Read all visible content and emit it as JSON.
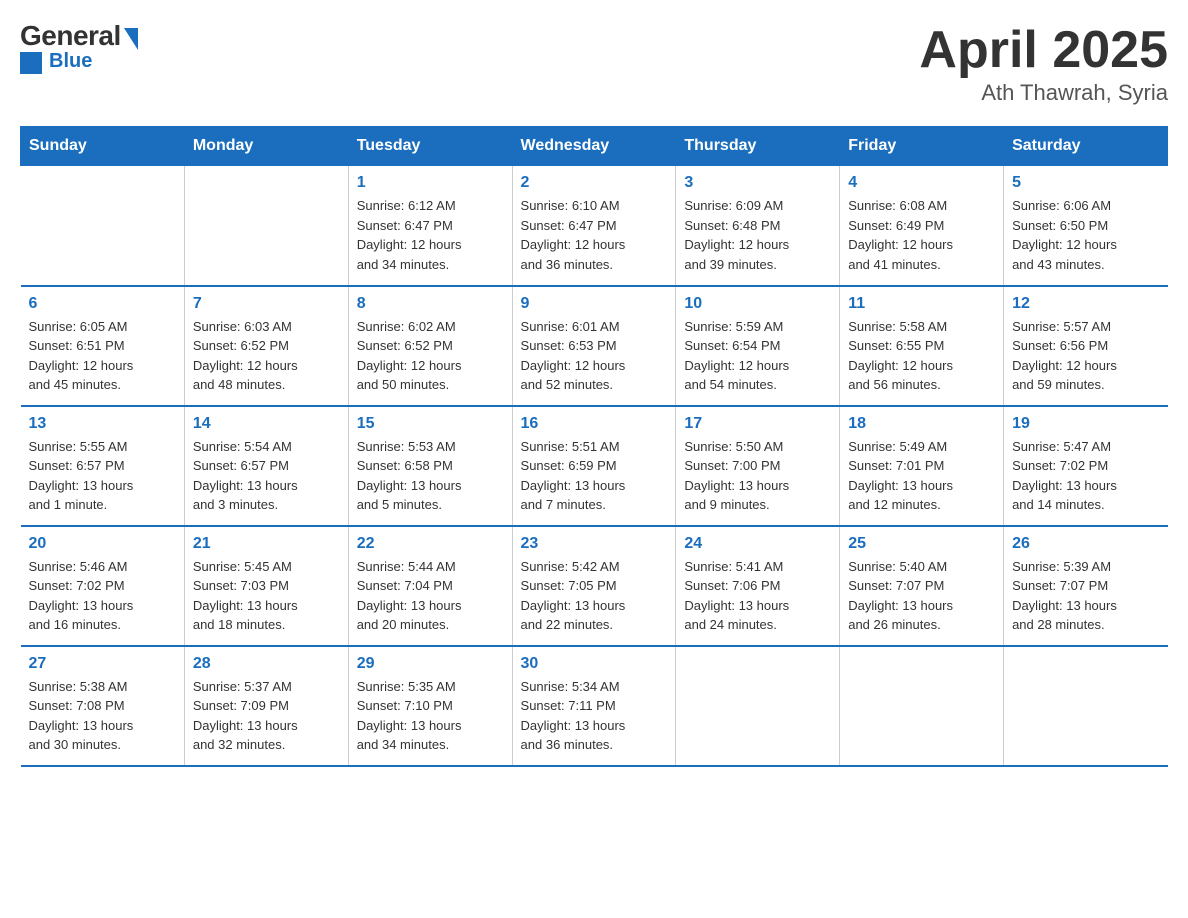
{
  "header": {
    "logo": {
      "general": "General",
      "blue": "Blue"
    },
    "title": "April 2025",
    "subtitle": "Ath Thawrah, Syria"
  },
  "weekdays": [
    "Sunday",
    "Monday",
    "Tuesday",
    "Wednesday",
    "Thursday",
    "Friday",
    "Saturday"
  ],
  "weeks": [
    [
      {
        "day": "",
        "info": ""
      },
      {
        "day": "",
        "info": ""
      },
      {
        "day": "1",
        "info": "Sunrise: 6:12 AM\nSunset: 6:47 PM\nDaylight: 12 hours\nand 34 minutes."
      },
      {
        "day": "2",
        "info": "Sunrise: 6:10 AM\nSunset: 6:47 PM\nDaylight: 12 hours\nand 36 minutes."
      },
      {
        "day": "3",
        "info": "Sunrise: 6:09 AM\nSunset: 6:48 PM\nDaylight: 12 hours\nand 39 minutes."
      },
      {
        "day": "4",
        "info": "Sunrise: 6:08 AM\nSunset: 6:49 PM\nDaylight: 12 hours\nand 41 minutes."
      },
      {
        "day": "5",
        "info": "Sunrise: 6:06 AM\nSunset: 6:50 PM\nDaylight: 12 hours\nand 43 minutes."
      }
    ],
    [
      {
        "day": "6",
        "info": "Sunrise: 6:05 AM\nSunset: 6:51 PM\nDaylight: 12 hours\nand 45 minutes."
      },
      {
        "day": "7",
        "info": "Sunrise: 6:03 AM\nSunset: 6:52 PM\nDaylight: 12 hours\nand 48 minutes."
      },
      {
        "day": "8",
        "info": "Sunrise: 6:02 AM\nSunset: 6:52 PM\nDaylight: 12 hours\nand 50 minutes."
      },
      {
        "day": "9",
        "info": "Sunrise: 6:01 AM\nSunset: 6:53 PM\nDaylight: 12 hours\nand 52 minutes."
      },
      {
        "day": "10",
        "info": "Sunrise: 5:59 AM\nSunset: 6:54 PM\nDaylight: 12 hours\nand 54 minutes."
      },
      {
        "day": "11",
        "info": "Sunrise: 5:58 AM\nSunset: 6:55 PM\nDaylight: 12 hours\nand 56 minutes."
      },
      {
        "day": "12",
        "info": "Sunrise: 5:57 AM\nSunset: 6:56 PM\nDaylight: 12 hours\nand 59 minutes."
      }
    ],
    [
      {
        "day": "13",
        "info": "Sunrise: 5:55 AM\nSunset: 6:57 PM\nDaylight: 13 hours\nand 1 minute."
      },
      {
        "day": "14",
        "info": "Sunrise: 5:54 AM\nSunset: 6:57 PM\nDaylight: 13 hours\nand 3 minutes."
      },
      {
        "day": "15",
        "info": "Sunrise: 5:53 AM\nSunset: 6:58 PM\nDaylight: 13 hours\nand 5 minutes."
      },
      {
        "day": "16",
        "info": "Sunrise: 5:51 AM\nSunset: 6:59 PM\nDaylight: 13 hours\nand 7 minutes."
      },
      {
        "day": "17",
        "info": "Sunrise: 5:50 AM\nSunset: 7:00 PM\nDaylight: 13 hours\nand 9 minutes."
      },
      {
        "day": "18",
        "info": "Sunrise: 5:49 AM\nSunset: 7:01 PM\nDaylight: 13 hours\nand 12 minutes."
      },
      {
        "day": "19",
        "info": "Sunrise: 5:47 AM\nSunset: 7:02 PM\nDaylight: 13 hours\nand 14 minutes."
      }
    ],
    [
      {
        "day": "20",
        "info": "Sunrise: 5:46 AM\nSunset: 7:02 PM\nDaylight: 13 hours\nand 16 minutes."
      },
      {
        "day": "21",
        "info": "Sunrise: 5:45 AM\nSunset: 7:03 PM\nDaylight: 13 hours\nand 18 minutes."
      },
      {
        "day": "22",
        "info": "Sunrise: 5:44 AM\nSunset: 7:04 PM\nDaylight: 13 hours\nand 20 minutes."
      },
      {
        "day": "23",
        "info": "Sunrise: 5:42 AM\nSunset: 7:05 PM\nDaylight: 13 hours\nand 22 minutes."
      },
      {
        "day": "24",
        "info": "Sunrise: 5:41 AM\nSunset: 7:06 PM\nDaylight: 13 hours\nand 24 minutes."
      },
      {
        "day": "25",
        "info": "Sunrise: 5:40 AM\nSunset: 7:07 PM\nDaylight: 13 hours\nand 26 minutes."
      },
      {
        "day": "26",
        "info": "Sunrise: 5:39 AM\nSunset: 7:07 PM\nDaylight: 13 hours\nand 28 minutes."
      }
    ],
    [
      {
        "day": "27",
        "info": "Sunrise: 5:38 AM\nSunset: 7:08 PM\nDaylight: 13 hours\nand 30 minutes."
      },
      {
        "day": "28",
        "info": "Sunrise: 5:37 AM\nSunset: 7:09 PM\nDaylight: 13 hours\nand 32 minutes."
      },
      {
        "day": "29",
        "info": "Sunrise: 5:35 AM\nSunset: 7:10 PM\nDaylight: 13 hours\nand 34 minutes."
      },
      {
        "day": "30",
        "info": "Sunrise: 5:34 AM\nSunset: 7:11 PM\nDaylight: 13 hours\nand 36 minutes."
      },
      {
        "day": "",
        "info": ""
      },
      {
        "day": "",
        "info": ""
      },
      {
        "day": "",
        "info": ""
      }
    ]
  ]
}
